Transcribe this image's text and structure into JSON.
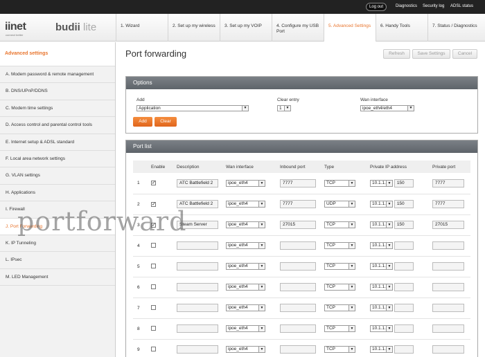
{
  "topbar": {
    "logout": "Log out",
    "links": [
      "Diagnostics",
      "Security log",
      "ADSL status"
    ]
  },
  "brand": {
    "iinet": "iinet",
    "tagline": "connect better",
    "product": "budii",
    "product_suffix": "lite"
  },
  "tabs": [
    {
      "label": "1. Wizard"
    },
    {
      "label": "2. Set up my wireless"
    },
    {
      "label": "3. Set up my VOIP"
    },
    {
      "label": "4. Configure my USB Port"
    },
    {
      "label": "5. Advanced Settings"
    },
    {
      "label": "6. Handy Tools"
    },
    {
      "label": "7. Status / Diagnostics"
    }
  ],
  "sidebar": {
    "title": "Advanced settings",
    "items": [
      "A. Modem password & remote management",
      "B. DNS/UPnP/DDNS",
      "C. Modem time settings",
      "D. Access control and parental control tools",
      "E. Internet setup & ADSL standard",
      "F. Local area network settings",
      "G. VLAN settings",
      "H. Applications",
      "I. Firewall",
      "J. Port Forwarding",
      "K. IP Tunneling",
      "L. IPsec",
      "M. LED Management"
    ]
  },
  "page": {
    "title": "Port forwarding",
    "refresh": "Refresh",
    "save": "Save Settings",
    "cancel": "Cancel"
  },
  "options": {
    "heading": "Options",
    "add_label": "Add",
    "add_value": "Application",
    "clear_label": "Clear entry",
    "clear_value": "1",
    "wan_label": "Wan interface",
    "wan_value": "ipoe_eth4/eth4",
    "add_btn": "Add",
    "clear_btn": "Clear"
  },
  "portlist": {
    "heading": "Port list",
    "columns": [
      "",
      "Enable",
      "Description",
      "Wan interface",
      "Inbound port",
      "Type",
      "Private IP address",
      "Private port"
    ],
    "rows": [
      {
        "n": "1",
        "en": "✓",
        "desc": "ATC Battlefield 2",
        "wan": "ipoe_eth4",
        "in": "7777",
        "type": "TCP",
        "ip": "10.1.1.",
        "ip4": "150",
        "pp": "7777"
      },
      {
        "n": "2",
        "en": "✓",
        "desc": "ATC Battlefield 2",
        "wan": "ipoe_eth4",
        "in": "7777",
        "type": "UDP",
        "ip": "10.1.1.",
        "ip4": "150",
        "pp": "7777"
      },
      {
        "n": "3",
        "en": "✓",
        "desc": "Steam Server",
        "wan": "ipoe_eth4",
        "in": "27015",
        "type": "TCP",
        "ip": "10.1.1.",
        "ip4": "150",
        "pp": "27015"
      },
      {
        "n": "4",
        "en": "",
        "desc": "",
        "wan": "ipoe_eth4",
        "in": "",
        "type": "TCP",
        "ip": "10.1.1.",
        "ip4": "",
        "pp": ""
      },
      {
        "n": "5",
        "en": "",
        "desc": "",
        "wan": "ipoe_eth4",
        "in": "",
        "type": "TCP",
        "ip": "10.1.1.",
        "ip4": "",
        "pp": ""
      },
      {
        "n": "6",
        "en": "",
        "desc": "",
        "wan": "ipoe_eth4",
        "in": "",
        "type": "TCP",
        "ip": "10.1.1.",
        "ip4": "",
        "pp": ""
      },
      {
        "n": "7",
        "en": "",
        "desc": "",
        "wan": "ipoe_eth4",
        "in": "",
        "type": "TCP",
        "ip": "10.1.1.",
        "ip4": "",
        "pp": ""
      },
      {
        "n": "8",
        "en": "",
        "desc": "",
        "wan": "ipoe_eth4",
        "in": "",
        "type": "TCP",
        "ip": "10.1.1.",
        "ip4": "",
        "pp": ""
      },
      {
        "n": "9",
        "en": "",
        "desc": "",
        "wan": "ipoe_eth4",
        "in": "",
        "type": "TCP",
        "ip": "10.1.1.",
        "ip4": "",
        "pp": ""
      }
    ]
  },
  "watermark": "portforward",
  "arrow_glyph": "▼"
}
